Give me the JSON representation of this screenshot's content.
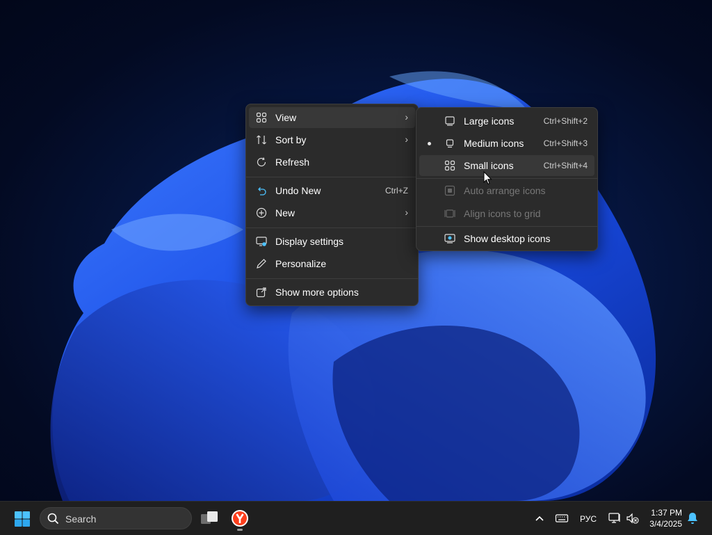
{
  "context_menu": {
    "items": [
      {
        "label": "View",
        "icon": "grid-icon",
        "has_submenu": true
      },
      {
        "label": "Sort by",
        "icon": "sort-icon",
        "has_submenu": true
      },
      {
        "label": "Refresh",
        "icon": "refresh-icon"
      },
      {
        "label": "Undo New",
        "icon": "undo-icon",
        "shortcut": "Ctrl+Z"
      },
      {
        "label": "New",
        "icon": "plus-circle-icon",
        "has_submenu": true
      },
      {
        "label": "Display settings",
        "icon": "display-settings-icon"
      },
      {
        "label": "Personalize",
        "icon": "pencil-icon"
      },
      {
        "label": "Show more options",
        "icon": "open-external-icon"
      }
    ]
  },
  "view_submenu": {
    "items": [
      {
        "label": "Large icons",
        "shortcut": "Ctrl+Shift+2",
        "icon": "large-icons-icon"
      },
      {
        "label": "Medium icons",
        "shortcut": "Ctrl+Shift+3",
        "icon": "medium-icons-icon",
        "selected": true
      },
      {
        "label": "Small icons",
        "shortcut": "Ctrl+Shift+4",
        "icon": "small-icons-icon"
      },
      {
        "label": "Auto arrange icons",
        "icon": "auto-arrange-icon",
        "disabled": true
      },
      {
        "label": "Align icons to grid",
        "icon": "align-grid-icon",
        "disabled": true
      },
      {
        "label": "Show desktop icons",
        "icon": "desktop-icon",
        "checked": true
      }
    ]
  },
  "taskbar": {
    "search_label": "Search",
    "language": "РУС",
    "time": "1:37 PM",
    "date": "3/4/2025"
  },
  "colors": {
    "accent": "#4cc2ff",
    "menu_bg": "#2b2b2b",
    "taskbar_bg": "#1f1f1f"
  }
}
